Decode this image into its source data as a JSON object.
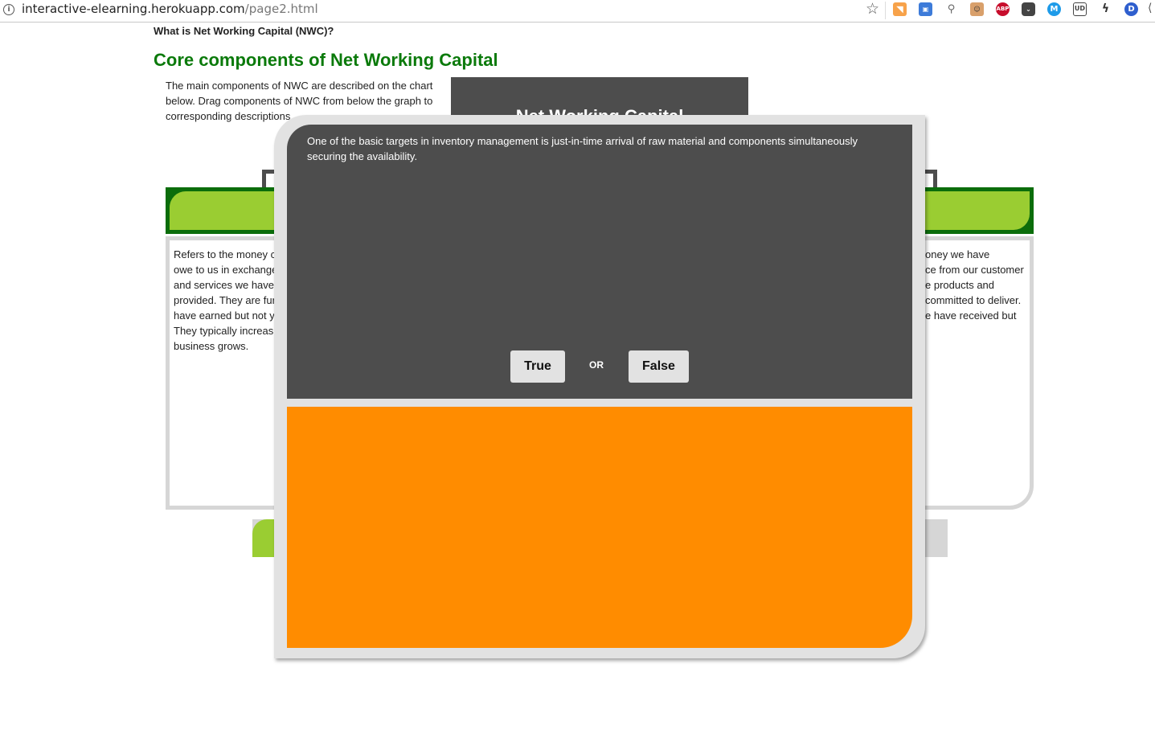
{
  "browser": {
    "url_host": "interactive-elearning.herokuapp.com",
    "url_path": "/page2.html",
    "extensions": [
      "rss-icon",
      "screenshot-icon",
      "key-search-icon",
      "face-icon",
      "adblock-plus-icon",
      "pocket-icon",
      "m-icon",
      "ud-icon",
      "bolt-icon",
      "d-icon"
    ]
  },
  "page": {
    "breadcrumb": "What is Net Working Capital (NWC)?",
    "title": "Core components of Net Working Capital",
    "intro": "The main components of NWC are described on the chart below. Drag components of NWC from below the graph to corresponding descriptions",
    "chart_title": "Net Working Capital",
    "left_card": {
      "lines": [
        "Refers to the money c",
        "owe to us in exchange",
        "and services we have",
        "provided. They are fur",
        "have earned but not y",
        "They typically increas",
        "business grows."
      ]
    },
    "right_card": {
      "lines": [
        "oney we have",
        "ce from our customer",
        "e products and",
        "committed to deliver.",
        "e have received but"
      ]
    }
  },
  "modal": {
    "question": "One of the basic targets in inventory management is just-in-time arrival of raw material and components simultaneously securing the availability.",
    "true_label": "True",
    "or_label": "OR",
    "false_label": "False"
  },
  "colors": {
    "title_green": "#0b7a0b",
    "dark_green": "#0b6d0b",
    "lime": "#9acd32",
    "panel_gray": "#4d4d4d",
    "feedback_orange": "#ff8c00"
  }
}
